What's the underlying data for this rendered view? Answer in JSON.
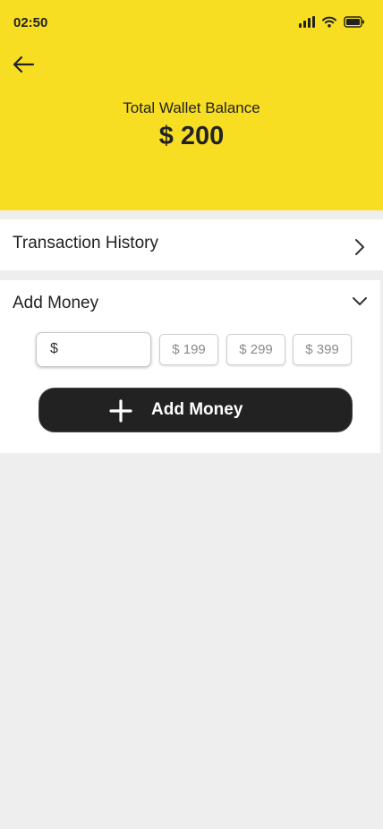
{
  "status_bar": {
    "time": "02:50"
  },
  "header": {
    "balance_label": "Total Wallet Balance",
    "balance_value": "$ 200",
    "background_color": "#f8de22"
  },
  "transaction_history": {
    "label": "Transaction History"
  },
  "add_money": {
    "title": "Add Money",
    "input": {
      "currency": "$",
      "value": "",
      "placeholder": ""
    },
    "presets": [
      "$ 199",
      "$ 299",
      "$ 399"
    ],
    "button_label": "Add Money"
  },
  "icons": {
    "back": "arrow-left-icon",
    "history": "chevron-right-icon",
    "add_section": "chevron-down-icon",
    "add_button": "plus-icon",
    "status": [
      "signal-icon",
      "wifi-icon",
      "battery-icon"
    ]
  },
  "colors": {
    "accent": "#f8de22",
    "button": "#222222",
    "background": "#eeeeee"
  }
}
